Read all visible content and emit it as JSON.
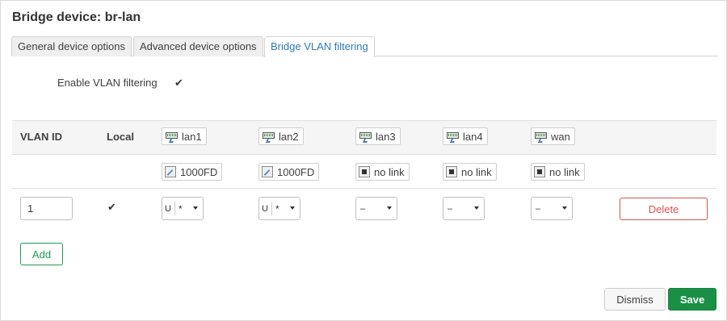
{
  "dialog": {
    "title": "Bridge device: br-lan"
  },
  "tabs": [
    {
      "label": "General device options"
    },
    {
      "label": "Advanced device options"
    },
    {
      "label": "Bridge VLAN filtering"
    }
  ],
  "vlan_filtering": {
    "label": "Enable VLAN filtering",
    "checked": true
  },
  "table": {
    "headers": {
      "vlan_id": "VLAN ID",
      "local": "Local"
    },
    "ports": [
      {
        "name": "lan1",
        "status": "1000FD",
        "linked": true,
        "membership": "U",
        "pvid": "*"
      },
      {
        "name": "lan2",
        "status": "1000FD",
        "linked": true,
        "membership": "U",
        "pvid": "*"
      },
      {
        "name": "lan3",
        "status": "no link",
        "linked": false,
        "membership": "–"
      },
      {
        "name": "lan4",
        "status": "no link",
        "linked": false,
        "membership": "–"
      },
      {
        "name": "wan",
        "status": "no link",
        "linked": false,
        "membership": "–"
      }
    ],
    "rows": [
      {
        "vlan_id": "1",
        "local": true,
        "delete_label": "Delete"
      }
    ]
  },
  "buttons": {
    "add": "Add",
    "dismiss": "Dismiss",
    "save": "Save"
  },
  "colors": {
    "accent_tab": "#2a7ab8",
    "save": "#1b8f46",
    "delete": "#d9534f",
    "add": "#1f9a5a"
  }
}
